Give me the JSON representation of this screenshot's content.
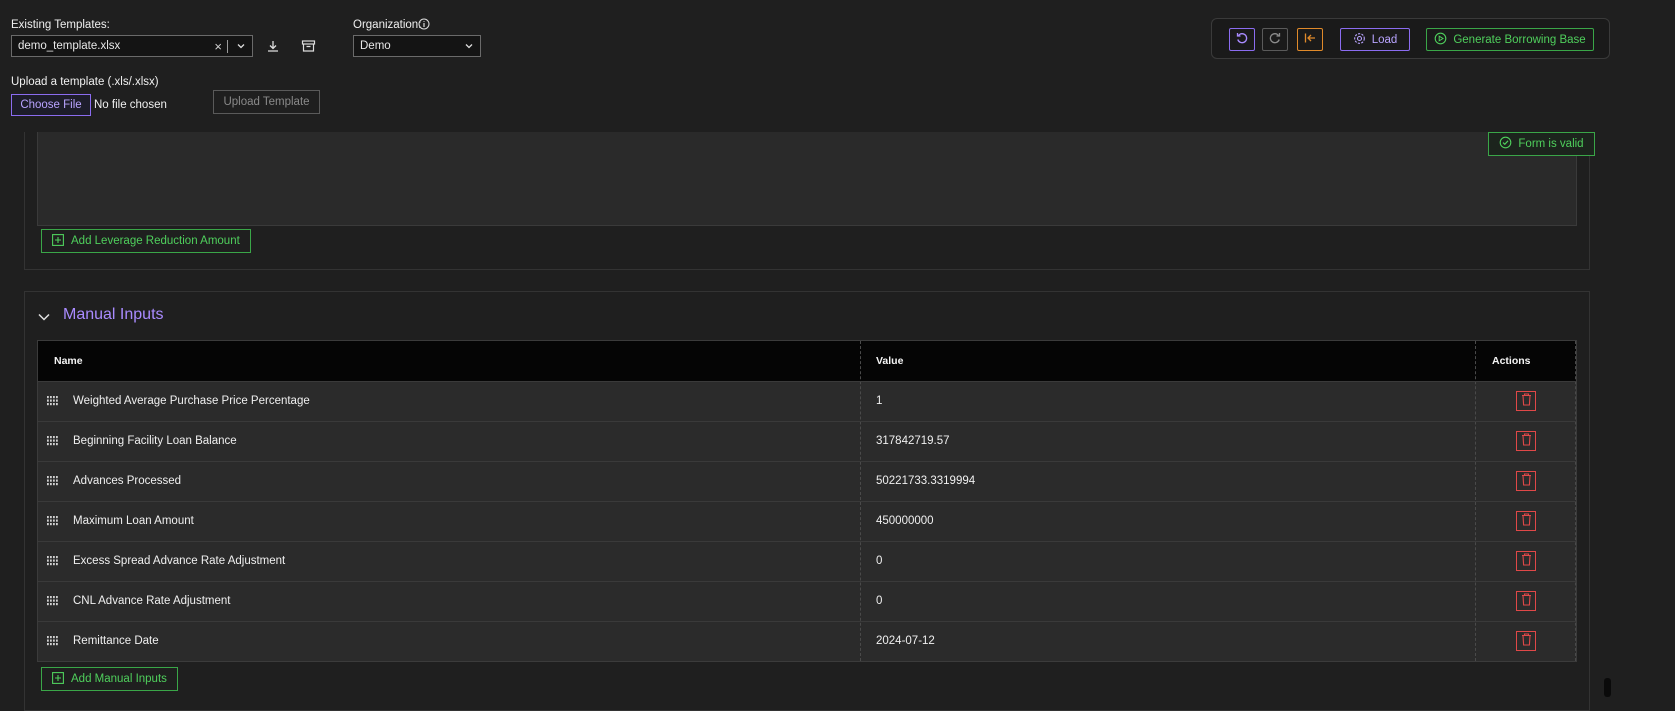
{
  "header": {
    "existing_templates_label": "Existing Templates:",
    "template_value": "demo_template.xlsx",
    "organization_label": "Organization:",
    "organization_value": "Demo",
    "upload_label": "Upload a template (.xls/.xlsx)",
    "choose_file": "Choose File",
    "no_file": "No file chosen",
    "upload_button": "Upload Template"
  },
  "toolbar": {
    "load": "Load",
    "generate": "Generate Borrowing Base"
  },
  "form_status": "Form is valid",
  "leverage": {
    "add_button": "Add Leverage Reduction Amount"
  },
  "manual_inputs": {
    "title": "Manual Inputs",
    "columns": {
      "name": "Name",
      "value": "Value",
      "actions": "Actions"
    },
    "rows": [
      {
        "name": "Weighted Average Purchase Price Percentage",
        "value": "1"
      },
      {
        "name": "Beginning Facility Loan Balance",
        "value": "317842719.57"
      },
      {
        "name": "Advances Processed",
        "value": "50221733.3319994"
      },
      {
        "name": "Maximum Loan Amount",
        "value": "450000000"
      },
      {
        "name": "Excess Spread Advance Rate Adjustment",
        "value": "0"
      },
      {
        "name": "CNL Advance Rate Adjustment",
        "value": "0"
      },
      {
        "name": "Remittance Date",
        "value": "2024-07-12"
      }
    ],
    "add_button": "Add Manual Inputs"
  },
  "colors": {
    "accent_purple": "#8b6cf0",
    "accent_green": "#3aa648",
    "accent_orange": "#e08a2a",
    "danger_red": "#e04848"
  }
}
